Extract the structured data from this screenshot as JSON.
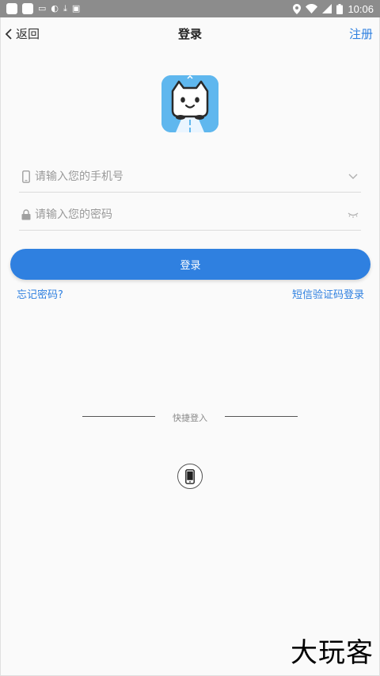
{
  "status_bar": {
    "time": "10:06",
    "icons_left": [
      "app-icon",
      "app-icon",
      "notification-icon",
      "location-icon",
      "download-icon",
      "text-icon"
    ],
    "icons_right": [
      "location-icon",
      "wifi-icon",
      "signal-icon",
      "battery-icon"
    ]
  },
  "header": {
    "back_label": "返回",
    "title": "登录",
    "register_label": "注册"
  },
  "form": {
    "phone_placeholder": "请输入您的手机号",
    "password_placeholder": "请输入您的密码",
    "login_label": "登录",
    "forgot_label": "忘记密码?",
    "sms_login_label": "短信验证码登录"
  },
  "quick_login": {
    "label": "快捷登入"
  },
  "watermark": "大玩客",
  "colors": {
    "accent": "#2f80e0",
    "logo_bg": "#5fb7ee"
  }
}
